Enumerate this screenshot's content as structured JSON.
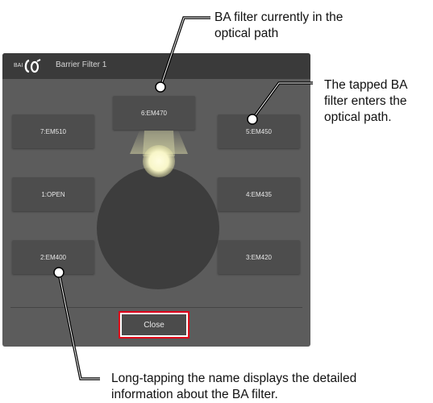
{
  "dialog": {
    "logo_prefix": "BAI",
    "title": "Barrier Filter 1",
    "close_label": "Close",
    "filters": {
      "f6": "6:EM470",
      "f7": "7:EM510",
      "f5": "5:EM450",
      "f1": "1:OPEN",
      "f4": "4:EM435",
      "f2": "2:EM400",
      "f3": "3:EM420"
    }
  },
  "callouts": {
    "top_line1": "BA filter currently in the",
    "top_line2": "optical path",
    "right_line1": "The tapped BA",
    "right_line2": "filter enters the",
    "right_line3": "optical path.",
    "bottom_line1": "Long-tapping the name displays the detailed",
    "bottom_line2": "information about the BA filter."
  },
  "colors": {
    "panel": "#5c5c5c",
    "titlebar": "#3a3a3a",
    "button": "#4d4d4d",
    "highlight": "#e0001b",
    "beam": "#f4f3b8"
  }
}
